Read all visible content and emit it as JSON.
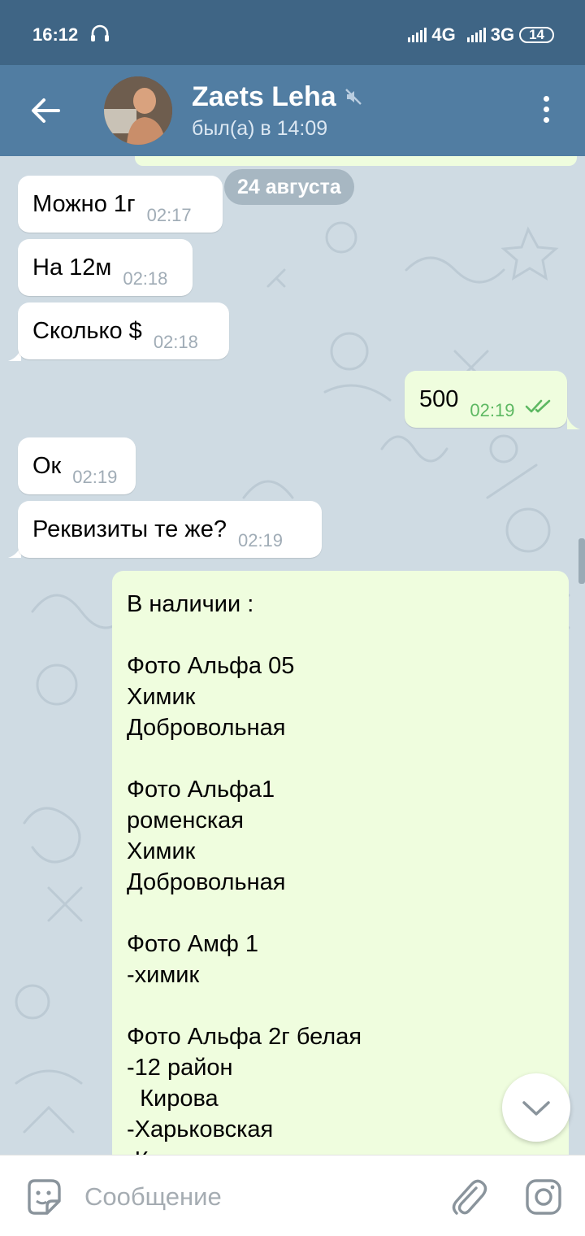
{
  "status_bar": {
    "time": "16:12",
    "network_1": "4G",
    "network_2": "3G",
    "battery": "14"
  },
  "header": {
    "contact_name": "Zaets Leha",
    "contact_status": "был(а) в 14:09"
  },
  "chat": {
    "date_separator": "24 августа",
    "messages": [
      {
        "direction": "in",
        "text": "Можно 1г",
        "time": "02:17"
      },
      {
        "direction": "in",
        "text": "На 12м",
        "time": "02:18"
      },
      {
        "direction": "in",
        "text": "Сколько $",
        "time": "02:18"
      },
      {
        "direction": "out",
        "text": "500",
        "time": "02:19",
        "status": "read"
      },
      {
        "direction": "in",
        "text": "Ок",
        "time": "02:19"
      },
      {
        "direction": "in",
        "text": "Реквизиты те же?",
        "time": "02:19"
      }
    ],
    "long_message": "В наличии :\n\nФото Альфа 05\nХимик\nДобровольная\n\nФото Альфа1\nроменская\nХимик\nДобровольная\n\nФото Амф 1\n-химик\n\nФото Альфа 2г белая\n-12 район\n  Кирова\n-Харьковская\n-Косовщинская"
  },
  "input": {
    "placeholder": "Сообщение"
  },
  "icons": {
    "back": "arrow-left-icon",
    "mute": "speaker-muted-icon",
    "menu": "more-vertical-icon",
    "scroll_down": "chevron-down-icon",
    "sticker": "sticker-icon",
    "attach": "paperclip-icon",
    "camera": "instagram-camera-icon"
  },
  "colors": {
    "header": "#517da2",
    "status_bar": "#3f6585",
    "outgoing_bubble": "#effdde",
    "incoming_bubble": "#ffffff",
    "read_check": "#5db862",
    "chat_background": "#cfdbe3"
  }
}
